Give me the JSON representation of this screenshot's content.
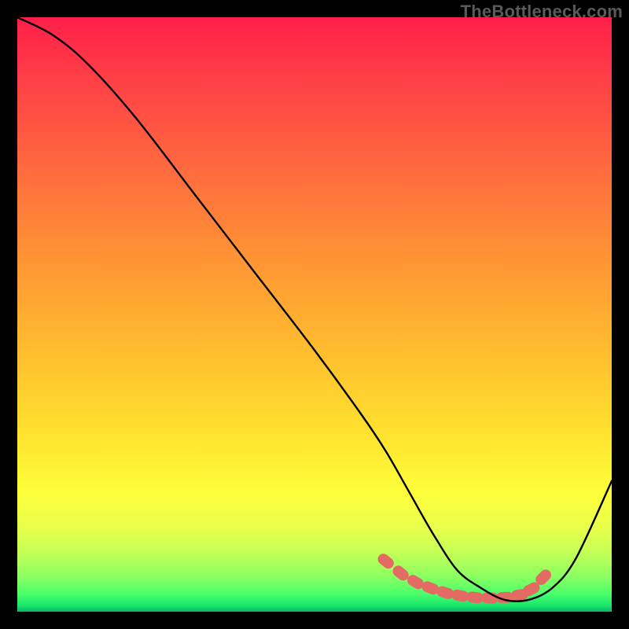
{
  "watermark": "TheBottleneck.com",
  "chart_data": {
    "type": "line",
    "title": "",
    "xlabel": "",
    "ylabel": "",
    "xlim": [
      0,
      100
    ],
    "ylim": [
      0,
      100
    ],
    "series": [
      {
        "name": "bottleneck-curve",
        "x": [
          0,
          6,
          12,
          20,
          30,
          40,
          50,
          58,
          62,
          66,
          70,
          74,
          78,
          82,
          86,
          90,
          94,
          100
        ],
        "y": [
          100,
          97,
          92,
          83,
          70,
          57,
          44,
          33,
          27,
          20,
          13,
          7,
          4,
          2,
          2,
          4,
          9,
          22
        ]
      }
    ],
    "markers": {
      "name": "highlight-dots",
      "x": [
        62,
        64.5,
        67,
        69.5,
        72,
        74.5,
        77,
        79.5,
        82,
        84.5,
        86.5,
        88.5
      ],
      "y": [
        8.5,
        6.5,
        5.0,
        4.0,
        3.2,
        2.7,
        2.4,
        2.3,
        2.4,
        2.8,
        3.8,
        5.8
      ]
    },
    "gradient_stops": [
      {
        "pos": 0,
        "color": "#ff1f4a"
      },
      {
        "pos": 10,
        "color": "#ff3e46"
      },
      {
        "pos": 22,
        "color": "#ff6040"
      },
      {
        "pos": 34,
        "color": "#ff8238"
      },
      {
        "pos": 46,
        "color": "#ffa232"
      },
      {
        "pos": 58,
        "color": "#ffc22e"
      },
      {
        "pos": 70,
        "color": "#ffe22e"
      },
      {
        "pos": 80,
        "color": "#feff3a"
      },
      {
        "pos": 86,
        "color": "#e7ff4a"
      },
      {
        "pos": 90,
        "color": "#c4ff56"
      },
      {
        "pos": 94,
        "color": "#8cff60"
      },
      {
        "pos": 97,
        "color": "#4bff6a"
      },
      {
        "pos": 99,
        "color": "#17e66e"
      },
      {
        "pos": 100,
        "color": "#0db565"
      }
    ],
    "colors": {
      "curve": "#000000",
      "markers": "#e46a64",
      "frame": "#000000"
    }
  }
}
